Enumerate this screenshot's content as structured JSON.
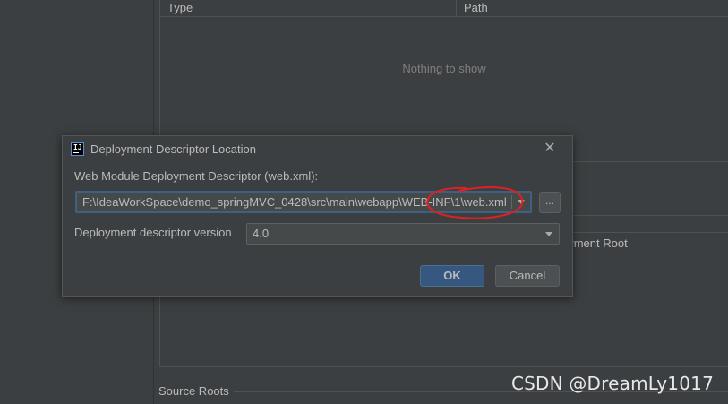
{
  "background": {
    "table": {
      "columns": [
        "Type",
        "Path"
      ],
      "empty_text": "Nothing to show"
    },
    "second_table": {
      "visible_header": "oyment Root"
    },
    "source_roots_label": "Source Roots"
  },
  "dialog": {
    "title": "Deployment Descriptor Location",
    "app_icon_text": "IJ",
    "descriptor_label": "Web Module Deployment Descriptor (web.xml):",
    "descriptor_path": "F:\\IdeaWorkSpace\\demo_springMVC_0428\\src\\main\\webapp\\WEB-INF\\1\\web.xml",
    "browse_label": "...",
    "version_label": "Deployment descriptor version",
    "version_value": "4.0",
    "ok_label": "OK",
    "cancel_label": "Cancel"
  },
  "watermark": "CSDN @DreamLy1017",
  "icons": [
    "intellij-icon",
    "close-icon",
    "chevron-down-icon"
  ],
  "colors": {
    "background": "#3c3f41",
    "focus_border": "#3d6185",
    "ok_button": "#365880",
    "annotation_red": "#e02020"
  }
}
